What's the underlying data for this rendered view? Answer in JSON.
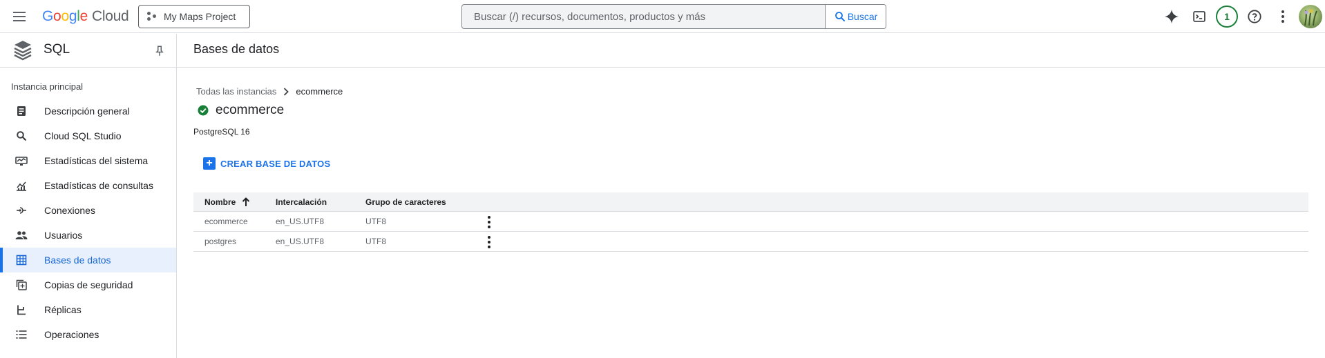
{
  "topbar": {
    "logo": {
      "g1": "G",
      "o1": "o",
      "o2": "o",
      "g2": "g",
      "l": "l",
      "e": "e",
      "product": "Cloud"
    },
    "project_label": "My Maps Project",
    "search": {
      "placeholder": "Buscar (/) recursos, documentos, productos y más",
      "button_label": "Buscar"
    },
    "notifications_count": "1"
  },
  "sidebar": {
    "title": "SQL",
    "section_label": "Instancia principal",
    "items": [
      {
        "label": "Descripción general",
        "icon": "overview-icon"
      },
      {
        "label": "Cloud SQL Studio",
        "icon": "search-icon"
      },
      {
        "label": "Estadísticas del sistema",
        "icon": "system-insights-icon"
      },
      {
        "label": "Estadísticas de consultas",
        "icon": "query-insights-icon"
      },
      {
        "label": "Conexiones",
        "icon": "connections-icon"
      },
      {
        "label": "Usuarios",
        "icon": "users-icon"
      },
      {
        "label": "Bases de datos",
        "icon": "databases-icon",
        "active": true
      },
      {
        "label": "Copias de seguridad",
        "icon": "backups-icon"
      },
      {
        "label": "Réplicas",
        "icon": "replicas-icon"
      },
      {
        "label": "Operaciones",
        "icon": "operations-icon"
      }
    ]
  },
  "main": {
    "page_title": "Bases de datos",
    "breadcrumb": {
      "parent": "Todas las instancias",
      "current": "ecommerce"
    },
    "instance": {
      "name": "ecommerce",
      "status": "running",
      "version": "PostgreSQL 16"
    },
    "create_button_label": "CREAR BASE DE DATOS",
    "table": {
      "columns": [
        "Nombre",
        "Intercalación",
        "Grupo de caracteres"
      ],
      "sort": {
        "column": "Nombre",
        "direction": "ascending"
      },
      "rows": [
        {
          "name": "ecommerce",
          "collation": "en_US.UTF8",
          "charset": "UTF8"
        },
        {
          "name": "postgres",
          "collation": "en_US.UTF8",
          "charset": "UTF8"
        }
      ]
    }
  },
  "colors": {
    "accent": "#1a73e8",
    "active_bg": "#e8f0fe",
    "success": "#188038",
    "border": "#dadce0"
  }
}
